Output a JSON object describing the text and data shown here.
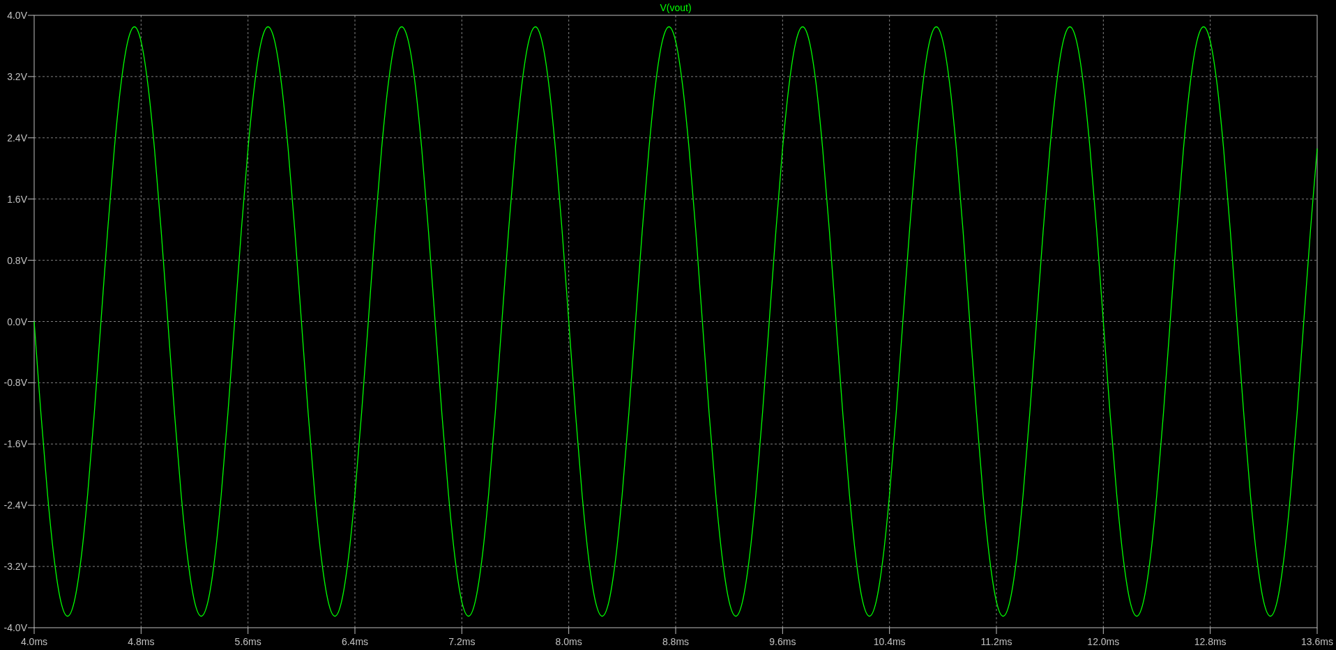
{
  "chart_data": {
    "type": "line",
    "grid": true,
    "x": [
      4.0,
      4.05,
      4.1,
      4.15,
      4.2,
      4.25,
      4.3,
      4.35,
      4.4,
      4.45,
      4.5,
      4.55,
      4.6,
      4.65,
      4.7,
      4.75,
      4.8,
      4.85,
      4.9,
      4.95,
      5.0,
      5.05,
      5.1,
      5.15,
      5.2,
      5.25,
      5.3,
      5.35,
      5.4,
      5.45,
      5.5,
      5.55,
      5.6,
      5.65,
      5.7,
      5.75,
      5.8,
      5.85,
      5.9,
      5.95,
      6.0,
      6.05,
      6.1,
      6.15,
      6.2,
      6.25,
      6.3,
      6.35,
      6.4,
      6.45,
      6.5,
      6.55,
      6.6,
      6.65,
      6.7,
      6.75,
      6.8,
      6.85,
      6.9,
      6.95,
      7.0,
      7.05,
      7.1,
      7.15,
      7.2,
      7.25,
      7.3,
      7.35,
      7.4,
      7.45,
      7.5,
      7.55,
      7.6,
      7.65,
      7.7,
      7.75,
      7.8,
      7.85,
      7.9,
      7.95,
      8.0,
      8.05,
      8.1,
      8.15,
      8.2,
      8.25,
      8.3,
      8.35,
      8.4,
      8.45,
      8.5,
      8.55,
      8.6,
      8.65,
      8.7,
      8.75,
      8.8,
      8.85,
      8.9,
      8.95,
      9.0,
      9.05,
      9.1,
      9.15,
      9.2,
      9.25,
      9.3,
      9.35,
      9.4,
      9.45,
      9.5,
      9.55,
      9.6,
      9.65,
      9.7,
      9.75,
      9.8,
      9.85,
      9.9,
      9.95,
      10.0,
      10.05,
      10.1,
      10.15,
      10.2,
      10.25,
      10.3,
      10.35,
      10.4,
      10.45,
      10.5,
      10.55,
      10.6,
      10.65,
      10.7,
      10.75,
      10.8,
      10.85,
      10.9,
      10.95,
      11.0,
      11.05,
      11.1,
      11.15,
      11.2,
      11.25,
      11.3,
      11.35,
      11.4,
      11.45,
      11.5,
      11.55,
      11.6,
      11.65,
      11.7,
      11.75,
      11.8,
      11.85,
      11.9,
      11.95,
      12.0,
      12.05,
      12.1,
      12.15,
      12.2,
      12.25,
      12.3,
      12.35,
      12.4,
      12.45,
      12.5,
      12.55,
      12.6,
      12.65,
      12.7,
      12.75,
      12.8,
      12.85,
      12.9,
      12.95,
      13.0,
      13.05,
      13.1,
      13.15,
      13.2,
      13.25,
      13.3,
      13.35,
      13.4,
      13.45,
      13.5,
      13.55,
      13.6
    ],
    "series": [
      {
        "name": "V(vout)",
        "color": "#00ff00",
        "values": [
          0,
          -1.19,
          -2.26,
          -3.11,
          -3.66,
          -3.85,
          -3.66,
          -3.11,
          -2.26,
          -1.19,
          0,
          1.19,
          2.26,
          3.11,
          3.66,
          3.85,
          3.66,
          3.11,
          2.26,
          1.19,
          0,
          -1.19,
          -2.26,
          -3.11,
          -3.66,
          -3.85,
          -3.66,
          -3.11,
          -2.26,
          -1.19,
          0,
          1.19,
          2.26,
          3.11,
          3.66,
          3.85,
          3.66,
          3.11,
          2.26,
          1.19,
          0,
          -1.19,
          -2.26,
          -3.11,
          -3.66,
          -3.85,
          -3.66,
          -3.11,
          -2.26,
          -1.19,
          0,
          1.19,
          2.26,
          3.11,
          3.66,
          3.85,
          3.66,
          3.11,
          2.26,
          1.19,
          0,
          -1.19,
          -2.26,
          -3.11,
          -3.66,
          -3.85,
          -3.66,
          -3.11,
          -2.26,
          -1.19,
          0,
          1.19,
          2.26,
          3.11,
          3.66,
          3.85,
          3.66,
          3.11,
          2.26,
          1.19,
          0,
          -1.19,
          -2.26,
          -3.11,
          -3.66,
          -3.85,
          -3.66,
          -3.11,
          -2.26,
          -1.19,
          0,
          1.19,
          2.26,
          3.11,
          3.66,
          3.85,
          3.66,
          3.11,
          2.26,
          1.19,
          0,
          -1.19,
          -2.26,
          -3.11,
          -3.66,
          -3.85,
          -3.66,
          -3.11,
          -2.26,
          -1.19,
          0,
          1.19,
          2.26,
          3.11,
          3.66,
          3.85,
          3.66,
          3.11,
          2.26,
          1.19,
          0,
          -1.19,
          -2.26,
          -3.11,
          -3.66,
          -3.85,
          -3.66,
          -3.11,
          -2.26,
          -1.19,
          0,
          1.19,
          2.26,
          3.11,
          3.66,
          3.85,
          3.66,
          3.11,
          2.26,
          1.19,
          0,
          -1.19,
          -2.26,
          -3.11,
          -3.66,
          -3.85,
          -3.66,
          -3.11,
          -2.26,
          -1.19,
          0,
          1.19,
          2.26,
          3.11,
          3.66,
          3.85,
          3.66,
          3.11,
          2.26,
          1.19,
          0,
          -1.19,
          -2.26,
          -3.11,
          -3.66,
          -3.85,
          -3.66,
          -3.11,
          -2.26,
          -1.19,
          0,
          1.19,
          2.26,
          3.11,
          3.66,
          3.85,
          3.66,
          3.11,
          2.26,
          1.19,
          0,
          -1.19,
          -2.26,
          -3.11,
          -3.66,
          -3.85,
          -3.66,
          -3.11,
          -2.26,
          -1.19,
          0,
          1.19,
          2.26
        ]
      }
    ],
    "xlim": [
      4.0,
      13.6
    ],
    "ylim": [
      -4.0,
      4.0
    ],
    "xticks": [
      {
        "value": 4.0,
        "label": "4.0ms"
      },
      {
        "value": 4.8,
        "label": "4.8ms"
      },
      {
        "value": 5.6,
        "label": "5.6ms"
      },
      {
        "value": 6.4,
        "label": "6.4ms"
      },
      {
        "value": 7.2,
        "label": "7.2ms"
      },
      {
        "value": 8.0,
        "label": "8.0ms"
      },
      {
        "value": 8.8,
        "label": "8.8ms"
      },
      {
        "value": 9.6,
        "label": "9.6ms"
      },
      {
        "value": 10.4,
        "label": "10.4ms"
      },
      {
        "value": 11.2,
        "label": "11.2ms"
      },
      {
        "value": 12.0,
        "label": "12.0ms"
      },
      {
        "value": 12.8,
        "label": "12.8ms"
      },
      {
        "value": 13.6,
        "label": "13.6ms"
      }
    ],
    "yticks": [
      {
        "value": 4.0,
        "label": "4.0V"
      },
      {
        "value": 3.2,
        "label": "3.2V"
      },
      {
        "value": 2.4,
        "label": "2.4V"
      },
      {
        "value": 1.6,
        "label": "1.6V"
      },
      {
        "value": 0.8,
        "label": "0.8V"
      },
      {
        "value": 0.0,
        "label": "0.0V"
      },
      {
        "value": -0.8,
        "label": "-0.8V"
      },
      {
        "value": -1.6,
        "label": "-1.6V"
      },
      {
        "value": -2.4,
        "label": "-2.4V"
      },
      {
        "value": -3.2,
        "label": "-3.2V"
      },
      {
        "value": -4.0,
        "label": "-4.0V"
      }
    ]
  }
}
